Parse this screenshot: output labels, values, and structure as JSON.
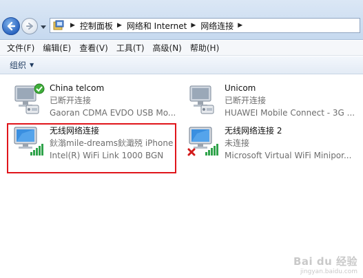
{
  "address_bar": {
    "breadcrumbs": [
      "控制面板",
      "网络和 Internet",
      "网络连接"
    ]
  },
  "menu": {
    "items": [
      "文件(F)",
      "编辑(E)",
      "查看(V)",
      "工具(T)",
      "高级(N)",
      "帮助(H)"
    ]
  },
  "command_bar": {
    "organize_label": "组织",
    "organize_caret": "▼"
  },
  "connections": [
    {
      "name": "China telcom",
      "status": "已断开连接",
      "device": "Gaoran CDMA EVDO USB Mo...",
      "icon": "wired-modem-connected-icon"
    },
    {
      "name": "Unicom",
      "status": "已断开连接",
      "device": "HUAWEI Mobile Connect - 3G ...",
      "icon": "wired-modem-icon"
    },
    {
      "name": "无线网络连接",
      "status": "鈥滃mile-dreams鈥濈殑 iPhone",
      "device": "Intel(R) WiFi Link 1000 BGN",
      "icon": "wireless-connected-icon",
      "highlighted": true
    },
    {
      "name": "无线网络连接 2",
      "status": "未连接",
      "device": "Microsoft Virtual WiFi Minipor...",
      "icon": "wireless-disconnected-icon"
    }
  ],
  "watermark": {
    "logo": "Bai du 经验",
    "url": "jingyan.baidu.com"
  },
  "colors": {
    "highlight_frame": "#e0141a",
    "signal_green": "#2fa34a",
    "disconnect_red": "#d21a1a"
  }
}
